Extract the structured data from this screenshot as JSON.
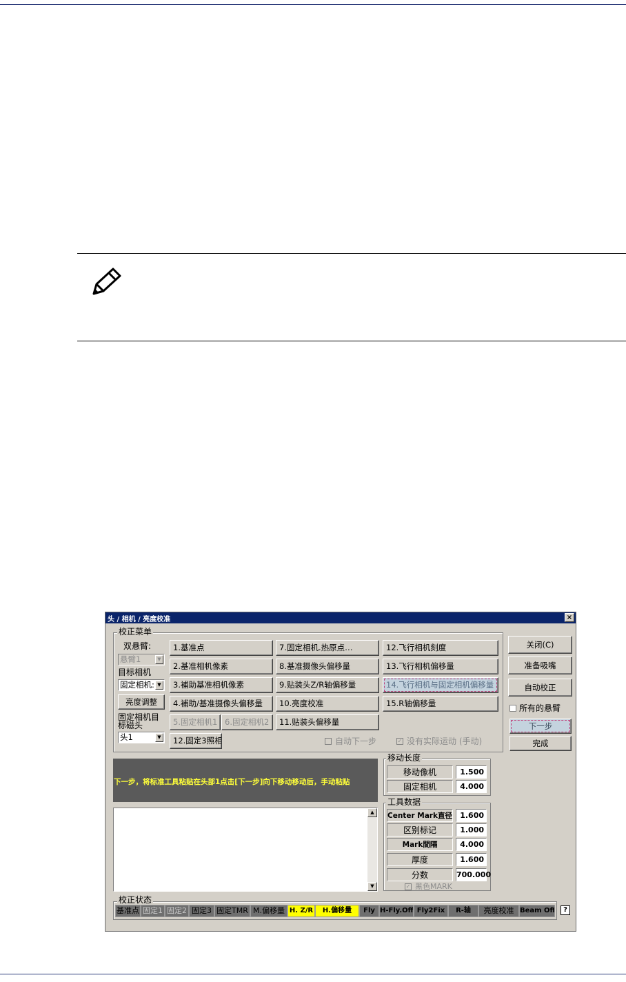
{
  "dialog": {
    "title": "头 / 相机 / 亮度校准",
    "close_x": "×",
    "calib_menu": {
      "label": "校正菜单",
      "dual_arm_label": "双悬臂:",
      "arm_combo": "悬臂1",
      "target_camera_label": "目标相机",
      "camera_combo": "固定相机:",
      "brightness_adjust": "亮度调整",
      "fixed_cam_label_line1": "固定相机目",
      "fixed_cam_label_line2": "标磁头",
      "head_combo": "头1",
      "col1": [
        "1.基准点",
        "2.基准相机像素",
        "3.補助基准相机像素",
        "4.補助/基准摄像头偏移量"
      ],
      "fixed_cam1": "5.固定相机1",
      "fixed_cam2": "6.固定相机2",
      "btn12": "12.固定3照相",
      "col2": [
        "7.固定相机.热原点…",
        "8.基准摄像头偏移量",
        "9.贴装头Z/R轴偏移量",
        "10.亮度校准",
        "11.贴装头偏移量"
      ],
      "col3": [
        "12.飞行相机刻度",
        "13.飞行相机偏移量",
        "14.飞行相机与固定相机偏移量",
        "15.R轴偏移量"
      ],
      "auto_next": "自动下一步",
      "no_motion": "没有实际运动 (手动)"
    },
    "side": {
      "close": "关闭(C)",
      "prepare_nozzle": "准备吸嘴",
      "auto_calib": "自动校正",
      "all_arms": "所有的悬臂",
      "next": "下一步",
      "finish": "完成"
    },
    "message": "下一步，将标准工具粘贴在头部1点击[下一步]向下移动移动后，手动粘贴",
    "move_length": {
      "label": "移动长度",
      "move_camera": "移动像机",
      "move_camera_val": "1.500",
      "fixed_camera": "固定相机",
      "fixed_camera_val": "4.000"
    },
    "tool_data": {
      "label": "工具数据",
      "center_mark": "Center Mark直径",
      "center_mark_val": "1.600",
      "diff_mark": "区别标记",
      "diff_mark_val": "1.000",
      "mark_gap": "Mark間隔",
      "mark_gap_val": "4.000",
      "thickness": "厚度",
      "thickness_val": "1.600",
      "score": "分数",
      "score_val": "700.000",
      "black_mark": "黑色MARK"
    },
    "status_bar": {
      "label": "校正状态",
      "items": [
        "基准点",
        "固定1",
        "固定2",
        "固定3",
        "固定TMR",
        "M.偏移量",
        "H. Z/R",
        "H.偏移量",
        "Fly",
        "H-Fly.Off",
        "Fly2Fix",
        "R-轴",
        "亮度校准",
        "Beam Off"
      ],
      "help": "?"
    }
  },
  "colors": {
    "title_bar": "#0a246a",
    "window": "#d4d0c8",
    "status_done": "#6f6f6f",
    "status_active": "#ffff00",
    "message_bg": "#5a5a5a",
    "message_text": "#ffff3a"
  }
}
